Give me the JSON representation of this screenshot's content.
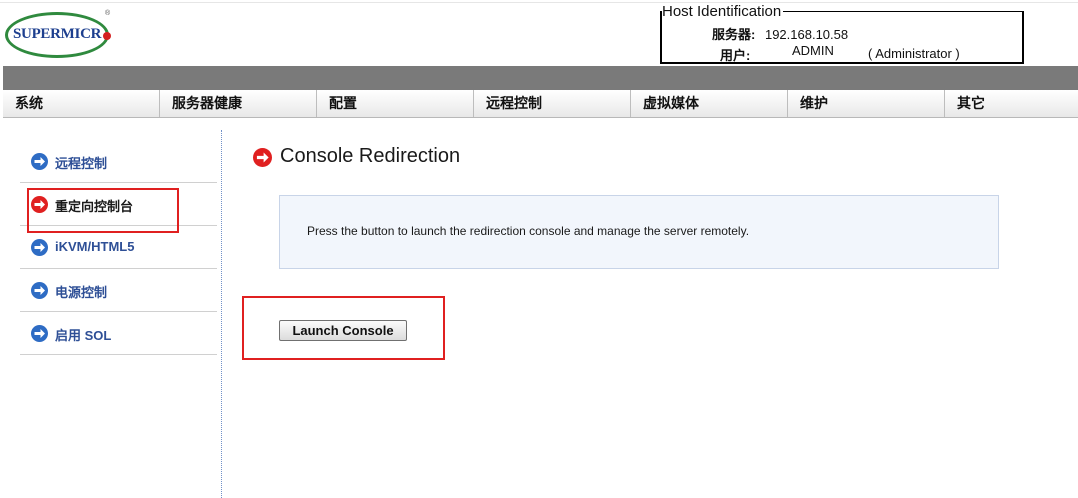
{
  "logo": {
    "text": "SUPERMICR",
    "tm": "®"
  },
  "host": {
    "title": "Host Identification",
    "server_label": "服务器:",
    "server_value": "192.168.10.58",
    "user_label": "用户:",
    "user_value": "ADMIN",
    "user_role": "( Administrator )"
  },
  "nav": {
    "items": [
      "系统",
      "服务器健康",
      "配置",
      "远程控制",
      "虚拟媒体",
      "维护",
      "其它"
    ]
  },
  "sidebar": {
    "items": [
      {
        "label": "远程控制",
        "icon": "arrow-right-blue-icon"
      },
      {
        "label": "重定向控制台",
        "icon": "arrow-right-red-icon"
      },
      {
        "label": "iKVM/HTML5",
        "icon": "arrow-right-blue-icon"
      },
      {
        "label": "电源控制",
        "icon": "arrow-right-blue-icon"
      },
      {
        "label": "启用 SOL",
        "icon": "arrow-right-blue-icon"
      }
    ],
    "active_index": 1
  },
  "main": {
    "title": "Console Redirection",
    "info": "Press the button to launch the redirection console and manage the server remotely.",
    "launch_label": "Launch Console"
  },
  "colors": {
    "accent_blue": "#2e6cc4",
    "accent_red": "#e02020",
    "brand_green": "#2f8a3e",
    "brand_navy": "#1d3f8f"
  }
}
